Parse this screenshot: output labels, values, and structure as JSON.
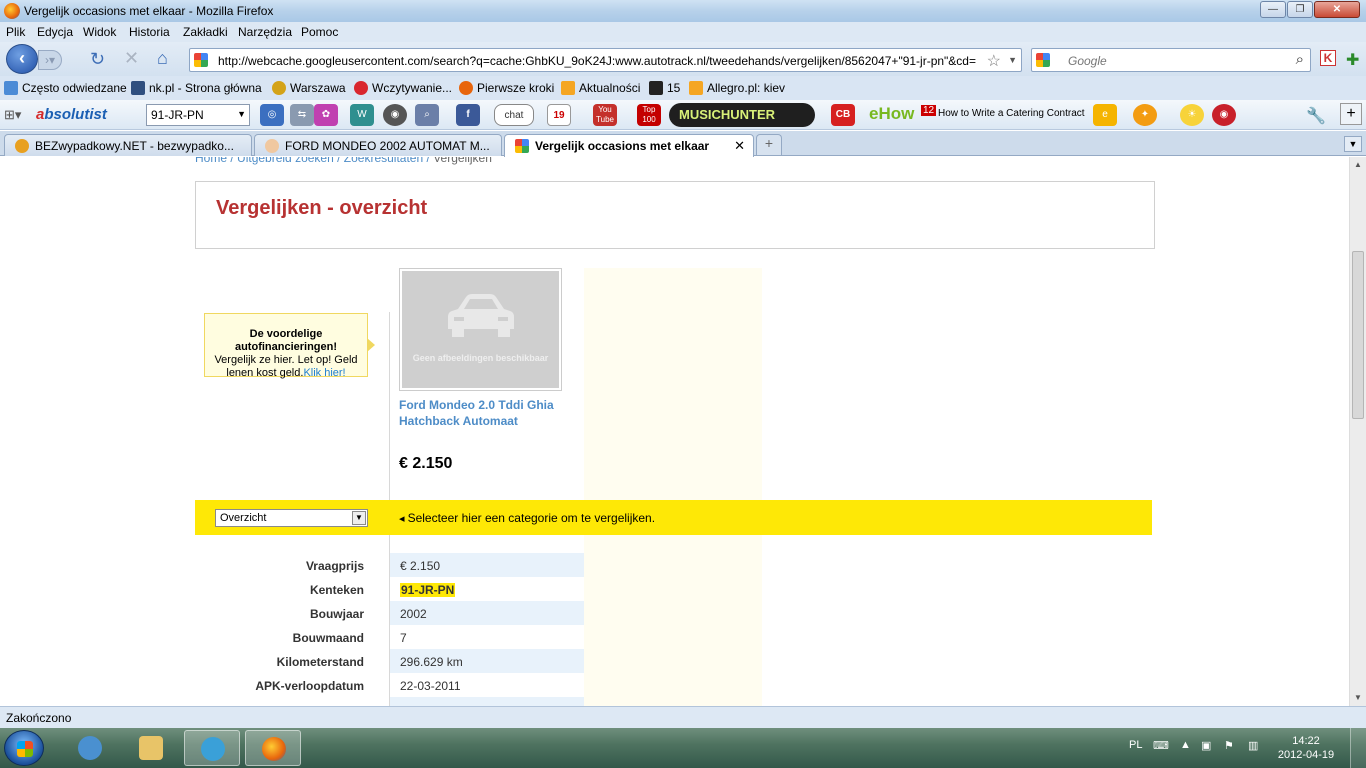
{
  "window": {
    "title": "Vergelijk occasions met elkaar - Mozilla Firefox",
    "minimize": "—",
    "maximize": "❐",
    "close": "✕"
  },
  "menu": [
    "Plik",
    "Edycja",
    "Widok",
    "Historia",
    "Zakładki",
    "Narzędzia",
    "Pomoc"
  ],
  "nav": {
    "url": "http://webcache.googleusercontent.com/search?q=cache:GhbKU_9oK24J:www.autotrack.nl/tweedehands/vergelijken/8562047+\"91-jr-pn\"&cd=",
    "search_placeholder": "Google"
  },
  "bookmarks": [
    "Często odwiedzane",
    "nk.pl - Strona główna",
    "Warszawa",
    "Wczytywanie...",
    "Pierwsze kroki",
    "Aktualności",
    "15",
    "Allegro.pl: kiev"
  ],
  "addon_toolbar": {
    "logo_a": "a",
    "logo_rest": "bsolutist",
    "combo_value": "91-JR-PN",
    "chat": "chat",
    "cal_day": "19",
    "youtube": "You Tube",
    "top100": "Top 100",
    "musichunter": "MUSICHUNTER",
    "cb": "CB",
    "ehow": "eHow",
    "ehow_count": "12",
    "catering": "How to Write a Catering Contract"
  },
  "tabs": [
    {
      "label": "BEZwypadkowy.NET - bezwypadko...",
      "active": false
    },
    {
      "label": "FORD MONDEO 2002 AUTOMAT M...",
      "active": false
    },
    {
      "label": "Vergelijk occasions met elkaar",
      "active": true
    }
  ],
  "page": {
    "breadcrumb": {
      "home": "Home",
      "uitgebreid": "Uitgebreid zoeken",
      "results": "Zoekresultaten",
      "current": "Vergelijken"
    },
    "heading": "Vergelijken - overzicht",
    "promo": {
      "title": "De voordelige autofinancieringen!",
      "body": "Vergelijk ze hier. Let op! Geld lenen kost geld.",
      "link": "Klik hier!"
    },
    "no_image": "Geen afbeeldingen beschikbaar",
    "car_title": "Ford Mondeo 2.0 Tddi Ghia Hatchback Automaat",
    "price": "€ 2.150",
    "category_select": "Overzicht",
    "category_hint": "Selecteer hier een categorie om te vergelijken.",
    "specs": [
      {
        "label": "Vraagprijs",
        "value": "€ 2.150"
      },
      {
        "label": "Kenteken",
        "value": "91-JR-PN"
      },
      {
        "label": "Bouwjaar",
        "value": "2002"
      },
      {
        "label": "Bouwmaand",
        "value": "7"
      },
      {
        "label": "Kilometerstand",
        "value": "296.629 km"
      },
      {
        "label": "APK-verloopdatum",
        "value": "22-03-2011"
      }
    ]
  },
  "status": "Zakończono",
  "taskbar": {
    "lang": "PL",
    "time": "14:22",
    "date": "2012-04-19"
  }
}
